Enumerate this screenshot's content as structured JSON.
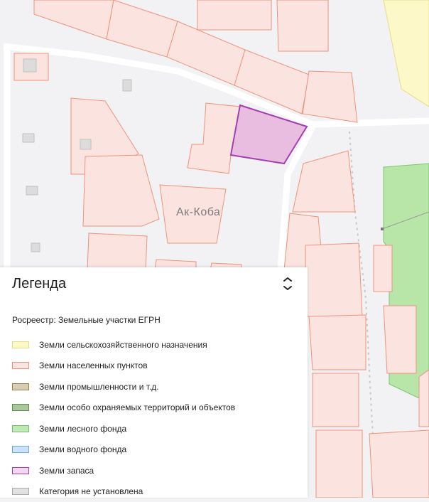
{
  "map": {
    "place_label": "Ак-Коба"
  },
  "legend": {
    "title": "Легенда",
    "toggle_icon": "chevrons-collapse-icon",
    "layer_title": "Росреестр: Земельные участки ЕГРН",
    "items": [
      {
        "label": "Земли сельскохозяйственного назначения",
        "fill": "#fdf8c8",
        "stroke": "#e6dd8c"
      },
      {
        "label": "Земли населенных пунктов",
        "fill": "#fbe3df",
        "stroke": "#f0937a"
      },
      {
        "label": "Земли промышленности и т.д.",
        "fill": "#d9cdb2",
        "stroke": "#9a7f52"
      },
      {
        "label": "Земли особо охраняемых территорий и объектов",
        "fill": "#a9c79a",
        "stroke": "#5f8c4a"
      },
      {
        "label": "Земли лесного фонда",
        "fill": "#bfe8b9",
        "stroke": "#6fc36a"
      },
      {
        "label": "Земли водного фонда",
        "fill": "#cbe2fb",
        "stroke": "#6fa8e6"
      },
      {
        "label": "Земли запаса",
        "fill": "#f3d6f1",
        "stroke": "#a33fb1"
      },
      {
        "label": "Категория не установлена",
        "fill": "#e2e2e2",
        "stroke": "#a9a9a9"
      }
    ]
  },
  "colors": {
    "parcel_fill": "#fbe3df",
    "parcel_stroke": "#f0937a",
    "selected_fill": "#e8b4dc",
    "selected_stroke": "#a33fb1",
    "road": "#ffffff",
    "forest": "#b8e6a8",
    "agri": "#fdf8c8"
  }
}
